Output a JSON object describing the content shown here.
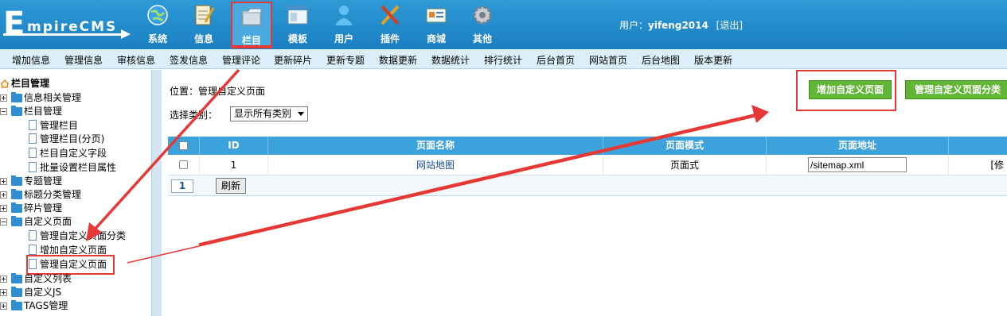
{
  "logo": {
    "first_letter": "E",
    "rest": "mpireCMS"
  },
  "main_nav": [
    {
      "label": "系统",
      "icon": "globe-icon"
    },
    {
      "label": "信息",
      "icon": "notepad-icon"
    },
    {
      "label": "栏目",
      "icon": "folder-icon",
      "active": true
    },
    {
      "label": "模板",
      "icon": "window-icon"
    },
    {
      "label": "用户",
      "icon": "user-icon"
    },
    {
      "label": "插件",
      "icon": "tools-icon"
    },
    {
      "label": "商城",
      "icon": "card-icon"
    },
    {
      "label": "其他",
      "icon": "gear-icon"
    }
  ],
  "user": {
    "prefix": "用户：",
    "name": "yifeng2014",
    "logout": "[退出]"
  },
  "sub_nav": [
    "增加信息",
    "管理信息",
    "审核信息",
    "签发信息",
    "管理评论",
    "更新碎片",
    "更新专题",
    "数据更新",
    "数据统计",
    "排行统计",
    "后台首页",
    "网站首页",
    "后台地图",
    "版本更新"
  ],
  "sidebar": {
    "root": "栏目管理",
    "items": [
      {
        "label": "信息相关管理",
        "type": "folder",
        "expanded": false,
        "level": 0
      },
      {
        "label": "栏目管理",
        "type": "folder",
        "expanded": true,
        "level": 0
      },
      {
        "label": "管理栏目",
        "type": "page",
        "level": 1
      },
      {
        "label": "管理栏目(分页)",
        "type": "page",
        "level": 1
      },
      {
        "label": "栏目自定义字段",
        "type": "page",
        "level": 1
      },
      {
        "label": "批量设置栏目属性",
        "type": "page",
        "level": 1
      },
      {
        "label": "专题管理",
        "type": "folder",
        "expanded": false,
        "level": 0
      },
      {
        "label": "标题分类管理",
        "type": "folder",
        "expanded": false,
        "level": 0
      },
      {
        "label": "碎片管理",
        "type": "folder",
        "expanded": false,
        "level": 0
      },
      {
        "label": "自定义页面",
        "type": "folder",
        "expanded": true,
        "level": 0
      },
      {
        "label": "管理自定义页面分类",
        "type": "page",
        "level": 1
      },
      {
        "label": "增加自定义页面",
        "type": "page",
        "level": 1
      },
      {
        "label": "管理自定义页面",
        "type": "page",
        "level": 1,
        "highlighted": true
      },
      {
        "label": "自定义列表",
        "type": "folder",
        "expanded": false,
        "level": 0
      },
      {
        "label": "自定义JS",
        "type": "folder",
        "expanded": false,
        "level": 0
      },
      {
        "label": "TAGS管理",
        "type": "folder",
        "expanded": false,
        "level": 0
      }
    ]
  },
  "main": {
    "location": "位置：管理自定义页面",
    "filter_label": "选择类别：",
    "filter_value": "显示所有类别",
    "add_button": "增加自定义页面",
    "manage_category_button": "管理自定义页面分类",
    "table": {
      "headers": [
        "",
        "ID",
        "页面名称",
        "页面模式",
        "页面地址",
        ""
      ],
      "rows": [
        {
          "id": "1",
          "name": "网站地图",
          "mode": "页面式",
          "url": "/sitemap.xml",
          "action": "[修"
        }
      ]
    },
    "page_number": "1",
    "refresh_button": "刷新"
  },
  "colors": {
    "header_blue": "#1b7fc1",
    "table_head": "#3ba2dc",
    "green_button": "#61b636",
    "annotation_red": "#e53935"
  }
}
